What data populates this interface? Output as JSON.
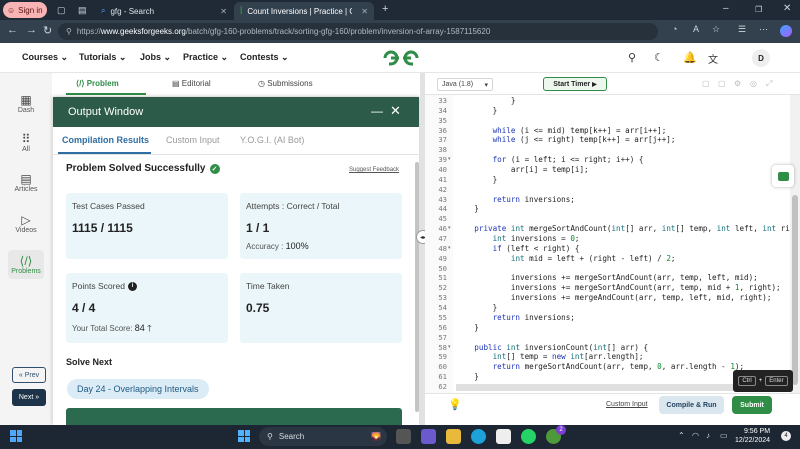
{
  "browser": {
    "signin_label": "Sign in",
    "tabs": [
      {
        "title": "gfg - Search"
      },
      {
        "title": "Count Inversions | Practice | Geek"
      }
    ],
    "url_domain": "www.geeksforgeeks.org",
    "url_path": "/batch/gfg-160-problems/track/sorting-gfg-160/problem/inversion-of-array-1587115620",
    "url_scheme": "https://"
  },
  "site": {
    "menu": [
      "Courses",
      "Tutorials",
      "Jobs",
      "Practice",
      "Contests"
    ],
    "avatar_letter": "D",
    "logo_colors": {
      "green": "#2f8d46"
    }
  },
  "rail": {
    "items": [
      {
        "label": "Dash",
        "icon": "dashboard-icon"
      },
      {
        "label": "All",
        "icon": "grid-icon"
      },
      {
        "label": "Articles",
        "icon": "article-icon"
      },
      {
        "label": "Videos",
        "icon": "video-icon"
      },
      {
        "label": "Problems",
        "icon": "code-icon"
      }
    ],
    "prev_label": "« Prev",
    "next_label": "Next »"
  },
  "problem_tabs": [
    "Problem",
    "Editorial",
    "Submissions"
  ],
  "output_window": {
    "title": "Output Window",
    "tabs": [
      "Compilation Results",
      "Custom Input",
      "Y.O.G.I. (AI Bot)"
    ],
    "status": "Problem Solved Successfully",
    "suggest_feedback": "Suggest Feedback",
    "cards": {
      "test_cases": {
        "label": "Test Cases Passed",
        "value": "1115 / 1115"
      },
      "attempts": {
        "label": "Attempts : Correct / Total",
        "value": "1 / 1",
        "accuracy_label": "Accuracy :",
        "accuracy_value": "100%"
      },
      "points": {
        "label": "Points Scored",
        "value": "4 / 4",
        "total_label": "Your Total Score:",
        "total_value": "84"
      },
      "time": {
        "label": "Time Taken",
        "value": "0.75"
      }
    },
    "solve_next": "Solve Next",
    "next_problem": "Day 24 - Overlapping Intervals"
  },
  "editor": {
    "language": "Java (1.8)",
    "timer_label": "Start Timer",
    "lines": [
      {
        "n": "33",
        "t": "            }"
      },
      {
        "n": "34",
        "t": "        }"
      },
      {
        "n": "35",
        "t": ""
      },
      {
        "n": "36",
        "t": "        while (i <= mid) temp[k++] = arr[i++];"
      },
      {
        "n": "37",
        "t": "        while (j <= right) temp[k++] = arr[j++];"
      },
      {
        "n": "38",
        "t": ""
      },
      {
        "n": "39",
        "t": "        for (i = left; i <= right; i++) {"
      },
      {
        "n": "40",
        "t": "            arr[i] = temp[i];"
      },
      {
        "n": "41",
        "t": "        }"
      },
      {
        "n": "42",
        "t": ""
      },
      {
        "n": "43",
        "t": "        return inversions;"
      },
      {
        "n": "44",
        "t": "    }"
      },
      {
        "n": "45",
        "t": ""
      },
      {
        "n": "46",
        "t": "    private int mergeSortAndCount(int[] arr, int[] temp, int left, int right) {"
      },
      {
        "n": "47",
        "t": "        int inversions = 0;"
      },
      {
        "n": "48",
        "t": "        if (left < right) {"
      },
      {
        "n": "49",
        "t": "            int mid = left + (right - left) / 2;"
      },
      {
        "n": "50",
        "t": ""
      },
      {
        "n": "51",
        "t": "            inversions += mergeSortAndCount(arr, temp, left, mid);"
      },
      {
        "n": "52",
        "t": "            inversions += mergeSortAndCount(arr, temp, mid + 1, right);"
      },
      {
        "n": "53",
        "t": "            inversions += mergeAndCount(arr, temp, left, mid, right);"
      },
      {
        "n": "54",
        "t": "        }"
      },
      {
        "n": "55",
        "t": "        return inversions;"
      },
      {
        "n": "56",
        "t": "    }"
      },
      {
        "n": "57",
        "t": ""
      },
      {
        "n": "58",
        "t": "    public int inversionCount(int[] arr) {"
      },
      {
        "n": "59",
        "t": "        int[] temp = new int[arr.length];"
      },
      {
        "n": "60",
        "t": "        return mergeSortAndCount(arr, temp, 0, arr.length - 1);"
      },
      {
        "n": "61",
        "t": "    }"
      },
      {
        "n": "62",
        "t": ""
      }
    ],
    "shortcut_ctrl": "Ctrl",
    "shortcut_plus": "+",
    "shortcut_enter": "Enter",
    "custom_input": "Custom Input",
    "compile_label": "Compile & Run",
    "submit_label": "Submit"
  },
  "taskbar": {
    "search_placeholder": "Search",
    "time": "9:56 PM",
    "date": "12/22/2024",
    "chat_badge": "2",
    "notif_badge": "4"
  }
}
